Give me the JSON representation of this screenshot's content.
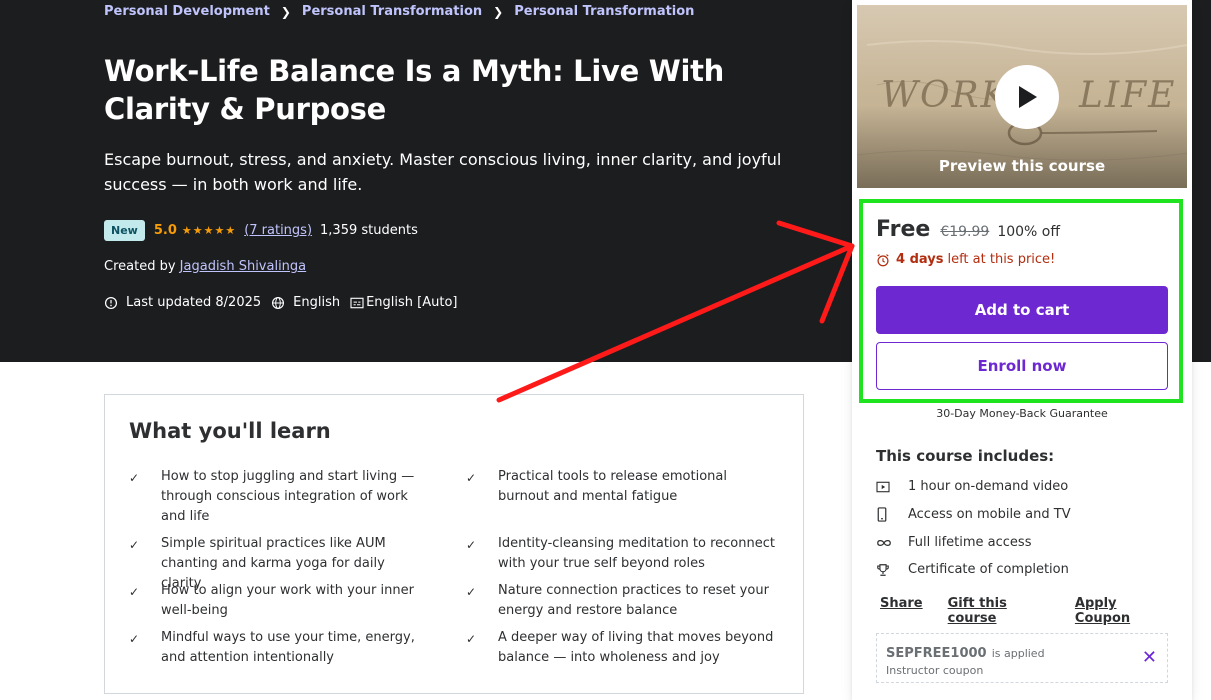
{
  "breadcrumb": [
    "Personal Development",
    "Personal Transformation",
    "Personal Transformation"
  ],
  "course": {
    "title": "Work-Life Balance Is a Myth: Live With Clarity & Purpose",
    "subtitle": "Escape burnout, stress, and anxiety. Master conscious living, inner clarity, and joyful success — in both work and life.",
    "badge": "New",
    "rating": "5.0",
    "stars": "★★★★★",
    "ratings_count": "(7 ratings)",
    "students": "1,359 students",
    "created_by_label": "Created by",
    "author": "Jagadish Shivalinga",
    "last_updated": "Last updated 8/2025",
    "language": "English",
    "captions": "English [Auto]"
  },
  "learn": {
    "heading": "What you'll learn",
    "check_glyph": "✓",
    "items": [
      "How to stop juggling and start living — through conscious integration of work and life",
      "Practical tools to release emotional burnout and mental fatigue",
      "Simple spiritual practices like AUM chanting and karma yoga for daily clarity",
      "Identity-cleansing meditation to reconnect with your true self beyond roles",
      "How to align your work with your inner well-being",
      "Nature connection practices to reset your energy and restore balance",
      "Mindful ways to use your time, energy, and attention intentionally",
      "A deeper way of living that moves beyond balance — into wholeness and joy"
    ]
  },
  "card": {
    "preview_label": "Preview this course",
    "price": "Free",
    "original_price": "€19.99",
    "discount": "100% off",
    "timer_days": "4 days",
    "timer_suffix": "left at this price!",
    "add_to_cart": "Add to cart",
    "enroll_now": "Enroll now",
    "guarantee": "30-Day Money-Back Guarantee",
    "includes_heading": "This course includes:",
    "includes": [
      {
        "icon": "video-icon",
        "text": "1 hour on-demand video"
      },
      {
        "icon": "mobile-icon",
        "text": "Access on mobile and TV"
      },
      {
        "icon": "infinity-icon",
        "text": "Full lifetime access"
      },
      {
        "icon": "trophy-icon",
        "text": "Certificate of completion"
      }
    ],
    "links": {
      "share": "Share",
      "gift": "Gift this course",
      "coupon": "Apply Coupon"
    },
    "coupon_code": "SEPFREE1000",
    "coupon_applied": "is applied",
    "coupon_type": "Instructor coupon",
    "coupon_remove": "✕"
  },
  "colors": {
    "header_bg": "#1c1d1f",
    "link": "#c0c4fc",
    "accent": "#6d28d2",
    "star": "#f69c08",
    "timer": "#b32d0f",
    "annotation_box": "#1ee31e",
    "annotation_arrow": "#ff1a1a"
  }
}
